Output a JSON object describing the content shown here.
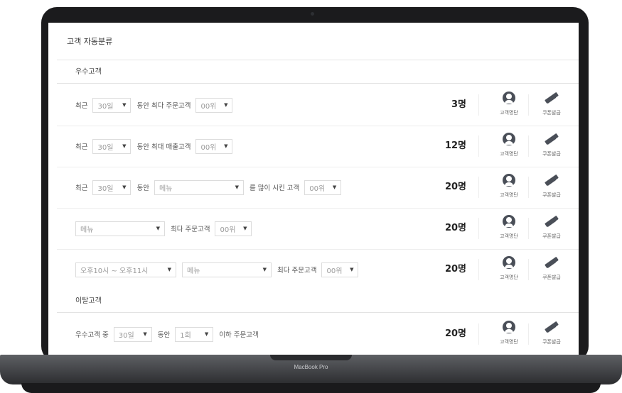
{
  "page_title": "고객 자동분류",
  "sections": {
    "vip": "우수고객",
    "churn": "이탈고객"
  },
  "rows": [
    {
      "t1": "최근",
      "s1": "30일",
      "t2": "동안 최다 주문고객",
      "s2": "00위",
      "count": "3명"
    },
    {
      "t1": "최근",
      "s1": "30일",
      "t2": "동안 최대 매출고객",
      "s2": "00위",
      "count": "12명"
    },
    {
      "t1": "최근",
      "s1": "30일",
      "t2": "동안",
      "s2": "메뉴",
      "t3": "를 많이 시킨 고객",
      "s3": "00위",
      "count": "20명"
    },
    {
      "s1": "메뉴",
      "t1": "최다 주문고객",
      "s2": "00위",
      "count": "20명"
    },
    {
      "s1": "오후10시 ~ 오후11시",
      "s2": "메뉴",
      "t1": "최다 주문고객",
      "s3": "00위",
      "count": "20명"
    },
    {
      "t1": "우수고객 중",
      "s1": "30일",
      "t2": "동안",
      "s2": "1회",
      "t3": "이하 주문고객",
      "count": "20명"
    }
  ],
  "actions": {
    "customer_list": "고객명단",
    "coupon_issue": "쿠폰발급"
  },
  "icons": {
    "customer_list": "person-icon",
    "coupon_issue": "coupon-icon",
    "dropdown": "dropdown-arrow"
  },
  "device_label": "MacBook Pro"
}
